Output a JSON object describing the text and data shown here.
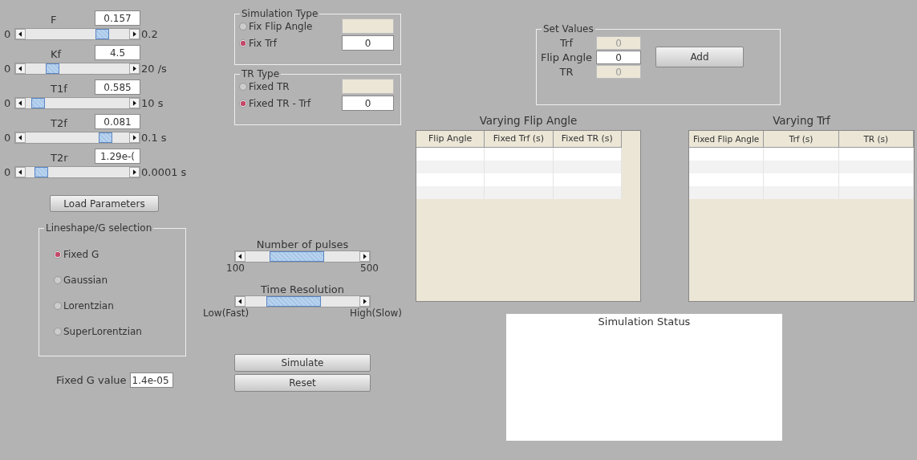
{
  "parameters": [
    {
      "label": "F",
      "value": "0.157",
      "min": "0",
      "max": "0.2",
      "level": 0.78
    },
    {
      "label": "Kf",
      "value": "4.5",
      "min": "0",
      "max": "20 /s",
      "level": 0.22
    },
    {
      "label": "T1f",
      "value": "0.585",
      "min": "0",
      "max": "10 s",
      "level": 0.06
    },
    {
      "label": "T2f",
      "value": "0.081",
      "min": "0",
      "max": "0.1 s",
      "level": 0.81
    },
    {
      "label": "T2r",
      "value": "1.29e-(",
      "min": "0",
      "max": "0.0001 s",
      "level": 0.1
    }
  ],
  "load_button": "Load Parameters",
  "lineshape": {
    "title": "Lineshape/G selection",
    "options": [
      {
        "label": "Fixed G",
        "selected": true
      },
      {
        "label": "Gaussian",
        "selected": false
      },
      {
        "label": "Lorentzian",
        "selected": false
      },
      {
        "label": "SuperLorentzian",
        "selected": false
      }
    ]
  },
  "fixed_g": {
    "label": "Fixed G value",
    "value": "1.4e-05"
  },
  "simulation_type": {
    "title": "Simulation Type",
    "options": [
      {
        "label": "Fix Flip Angle",
        "selected": false,
        "disabled": true
      },
      {
        "label": "Fix Trf",
        "selected": true,
        "disabled": false,
        "value": "0"
      }
    ]
  },
  "tr_type": {
    "title": "TR Type",
    "options": [
      {
        "label": "Fixed TR",
        "selected": false,
        "disabled": true
      },
      {
        "label": "Fixed TR - Trf",
        "selected": true,
        "disabled": false,
        "value": "0"
      }
    ]
  },
  "pulses": {
    "title": "Number of pulses",
    "min": "100",
    "max": "500",
    "level": 0.4
  },
  "time_resolution": {
    "title": "Time Resolution",
    "min": "Low(Fast)",
    "max": "High(Slow)",
    "level": 0.35
  },
  "buttons": [
    "Simulate",
    "Reset"
  ],
  "set_values": {
    "title": "Set Values",
    "fields": [
      {
        "label": "Trf",
        "value": "0",
        "disabled": true
      },
      {
        "label": "Flip Angle",
        "value": "0",
        "disabled": false
      },
      {
        "label": "TR",
        "value": "0",
        "disabled": true
      }
    ],
    "button": "Add"
  },
  "tables": [
    {
      "title": "Varying Flip Angle",
      "columns": [
        "Flip Angle",
        "Fixed Trf (s)",
        "Fixed TR (s)"
      ]
    },
    {
      "title": "Varying Trf",
      "columns": [
        "Fixed Flip Angle",
        "Trf (s)",
        "TR (s)"
      ]
    }
  ],
  "status": {
    "title": "Simulation Status"
  }
}
